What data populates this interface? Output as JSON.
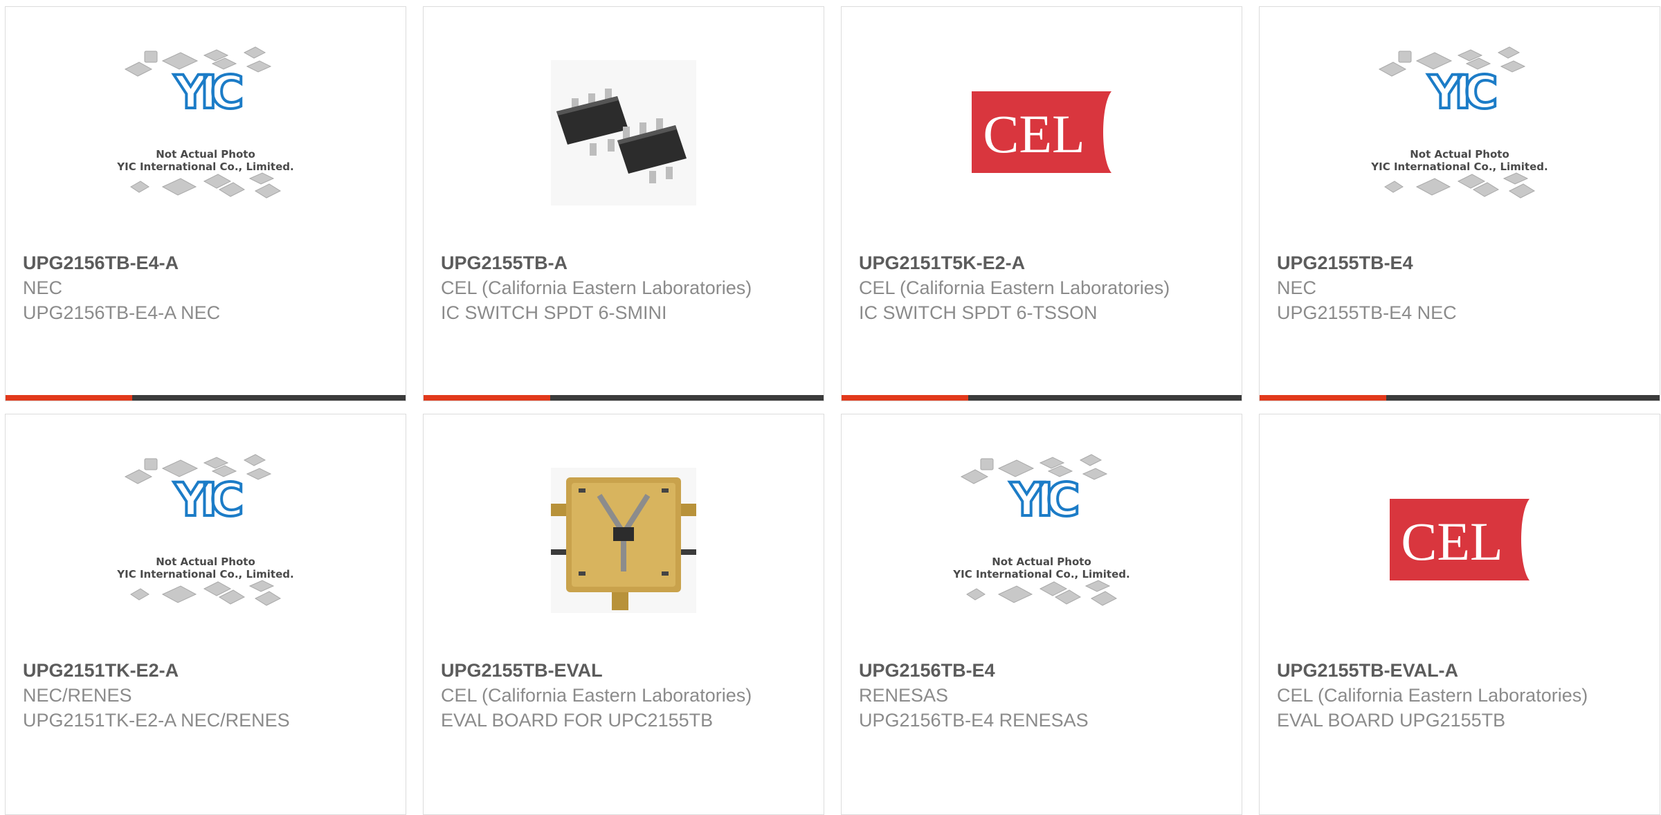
{
  "placeholder": {
    "line1": "Not Actual Photo",
    "line2": "YIC International Co., Limited.",
    "logo_text": "YIC"
  },
  "cel_logo_text": "CEL",
  "products": [
    {
      "part": "UPG2156TB-E4-A",
      "manufacturer": "NEC",
      "description": "UPG2156TB-E4-A NEC",
      "image": "yic-placeholder"
    },
    {
      "part": "UPG2155TB-A",
      "manufacturer": "CEL (California Eastern Laboratories)",
      "description": "IC SWITCH SPDT 6-SMINI",
      "image": "smini-package-photo"
    },
    {
      "part": "UPG2151T5K-E2-A",
      "manufacturer": "CEL (California Eastern Laboratories)",
      "description": "IC SWITCH SPDT 6-TSSON",
      "image": "cel-logo"
    },
    {
      "part": "UPG2155TB-E4",
      "manufacturer": "NEC",
      "description": "UPG2155TB-E4 NEC",
      "image": "yic-placeholder"
    },
    {
      "part": "UPG2151TK-E2-A",
      "manufacturer": "NEC/RENES",
      "description": "UPG2151TK-E2-A NEC/RENES",
      "image": "yic-placeholder"
    },
    {
      "part": "UPG2155TB-EVAL",
      "manufacturer": "CEL (California Eastern Laboratories)",
      "description": "EVAL BOARD FOR UPC2155TB",
      "image": "eval-board-photo"
    },
    {
      "part": "UPG2156TB-E4",
      "manufacturer": "RENESAS",
      "description": "UPG2156TB-E4 RENESAS",
      "image": "yic-placeholder"
    },
    {
      "part": "UPG2155TB-EVAL-A",
      "manufacturer": "CEL (California Eastern Laboratories)",
      "description": "EVAL BOARD UPG2155TB",
      "image": "cel-logo"
    }
  ],
  "colors": {
    "accent": "#e2391b",
    "bar": "#3b3b3b",
    "cel_red": "#d9363e",
    "yic_blue": "#1c7cc7"
  }
}
